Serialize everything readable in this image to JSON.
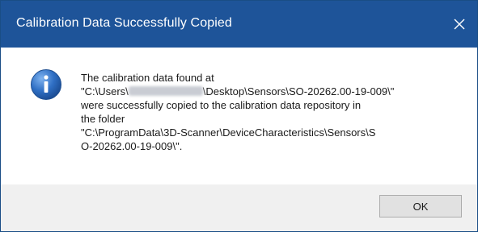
{
  "dialog": {
    "title": "Calibration Data Successfully Copied",
    "close_icon": "close-icon",
    "info_icon": "information-icon",
    "message": {
      "line1": "The calibration data found at",
      "line2_prefix": "\"C:\\Users\\",
      "line2_suffix": "\\Desktop\\Sensors\\SO-20262.00-19-009\\\"",
      "line3": "were successfully copied to the calibration data repository in",
      "line4": "the folder",
      "line5": "\"C:\\ProgramData\\3D-Scanner\\DeviceCharacteristics\\Sensors\\S",
      "line6": "O-20262.00-19-009\\\"."
    },
    "ok_label": "OK"
  },
  "colors": {
    "titlebar": "#1e5499",
    "footer": "#f0f0f0",
    "button": "#e1e1e1"
  }
}
